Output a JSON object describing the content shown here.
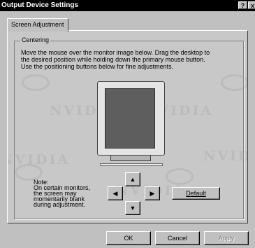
{
  "window": {
    "title": "Output Device Settings",
    "help_label": "?",
    "close_label": "x"
  },
  "tab": {
    "label": "Screen Adjustment"
  },
  "group": {
    "label": "Centering"
  },
  "instructions": [
    "Move the mouse over the monitor image below. Drag the desktop to",
    "the desired position while holding down the primary mouse button.",
    "Use the positioning buttons below for fine adjustments."
  ],
  "watermark": {
    "text": "NVIDIA"
  },
  "note": {
    "lines": [
      "Note:",
      "On certain monitors,",
      "the screen may",
      "momentarily blank",
      "during adjustment."
    ]
  },
  "positioning": {
    "up": "▲",
    "down": "▼",
    "left": "◀",
    "right": "▶"
  },
  "buttons": {
    "default": "Default",
    "ok": "OK",
    "cancel": "Cancel",
    "apply": "Apply"
  },
  "colors": {
    "title_bg": "#000000",
    "dialog_bg": "#c0c0c0",
    "monitor_screen": "#5e5e5e"
  }
}
